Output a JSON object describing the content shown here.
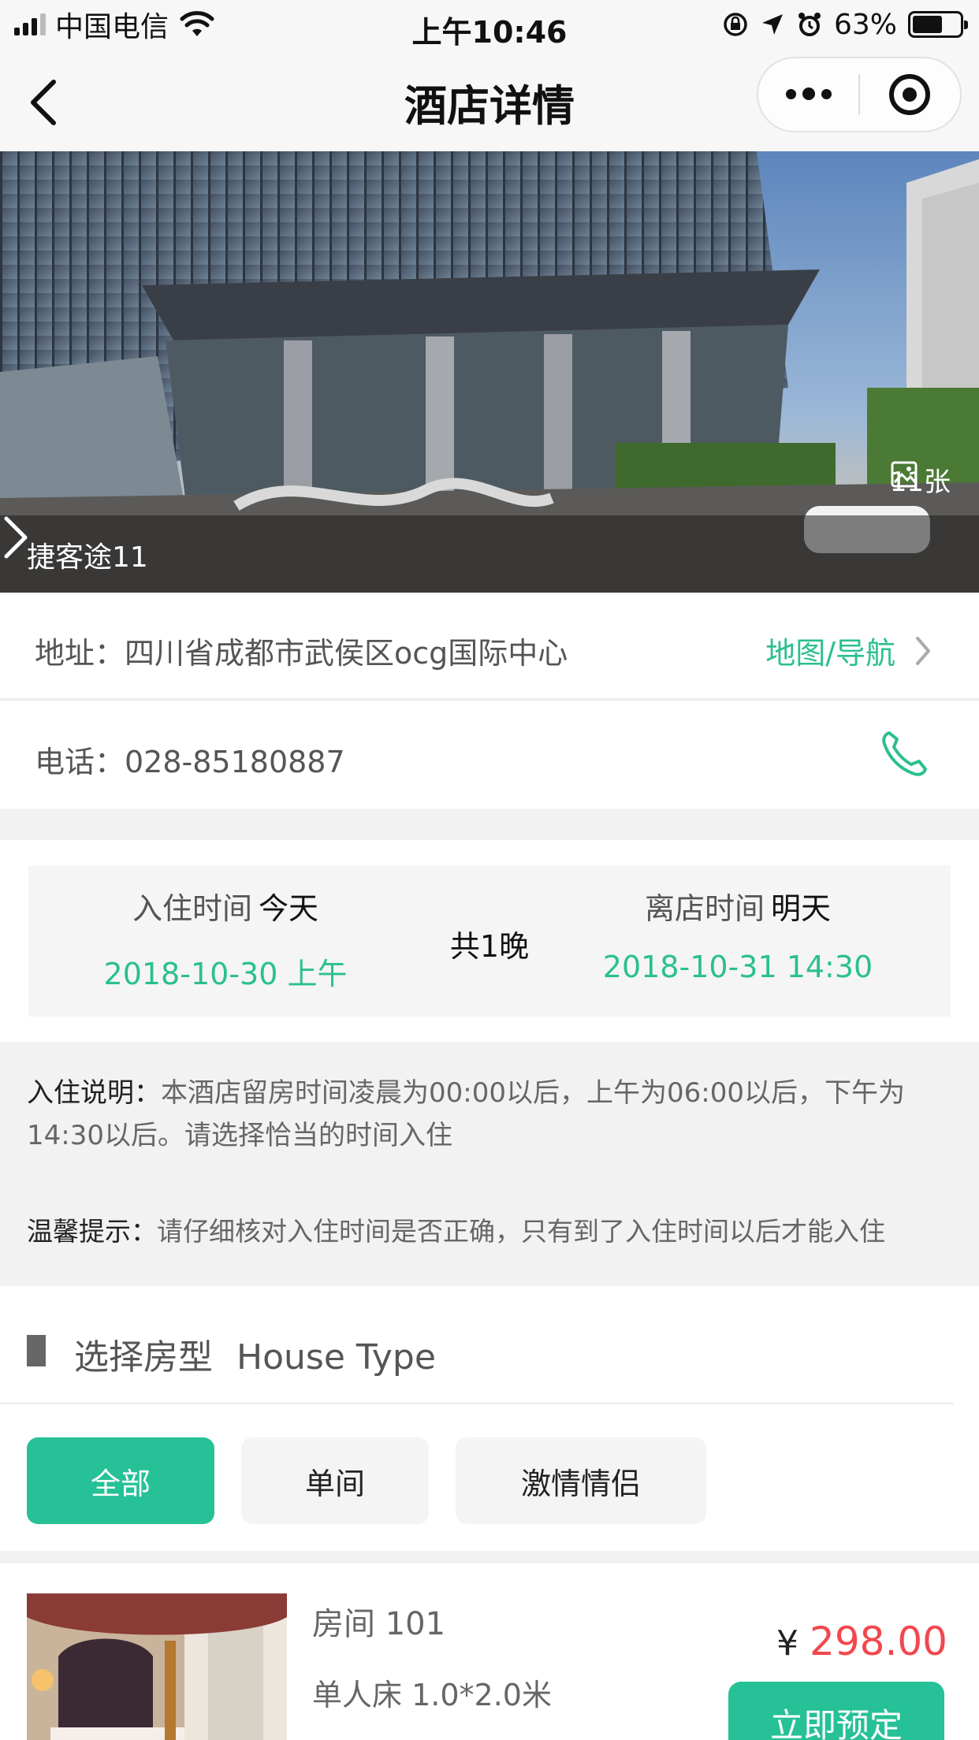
{
  "status_bar": {
    "carrier": "中国电信",
    "time": "上午10:46",
    "battery": "63%",
    "battery_level": 0.63
  },
  "nav": {
    "title": "酒店详情",
    "icons": [
      "back-chevron-icon",
      "more-dots-icon",
      "close-target-icon"
    ]
  },
  "hero": {
    "photo_count": "11张",
    "hotel_name": "捷客途11"
  },
  "address": {
    "text": "地址：四川省成都市武侯区ocg国际中心",
    "map_link": "地图/导航"
  },
  "phone": {
    "text": "电话：028-85180887"
  },
  "stay": {
    "checkin_label": "入住时间",
    "checkin_day": "今天",
    "checkin_value": "2018-10-30 上午",
    "nights": "共1晚",
    "checkout_label": "离店时间",
    "checkout_day": "明天",
    "checkout_value": "2018-10-31 14:30"
  },
  "notes": {
    "checkin_title": "入住说明：",
    "checkin_text": "本酒店留房时间凌晨为00:00以后，上午为06:00以后，下午为14:30以后。请选择恰当的时间入住",
    "tip_title": "温馨提示：",
    "tip_text": "请仔细核对入住时间是否正确，只有到了入住时间以后才能入住"
  },
  "room_types": {
    "title": "选择房型",
    "title_en": "House Type",
    "filters": [
      "全部",
      "单间",
      "激情情侣"
    ],
    "active_index": 0
  },
  "rooms": [
    {
      "name": "房间 101",
      "bed": "单人床   1.0*2.0米",
      "currency": "¥",
      "price": "298.00",
      "book_label": "立即预定"
    }
  ],
  "colors": {
    "accent": "#26c196",
    "link": "#2bbf91",
    "price": "#f2474e"
  }
}
